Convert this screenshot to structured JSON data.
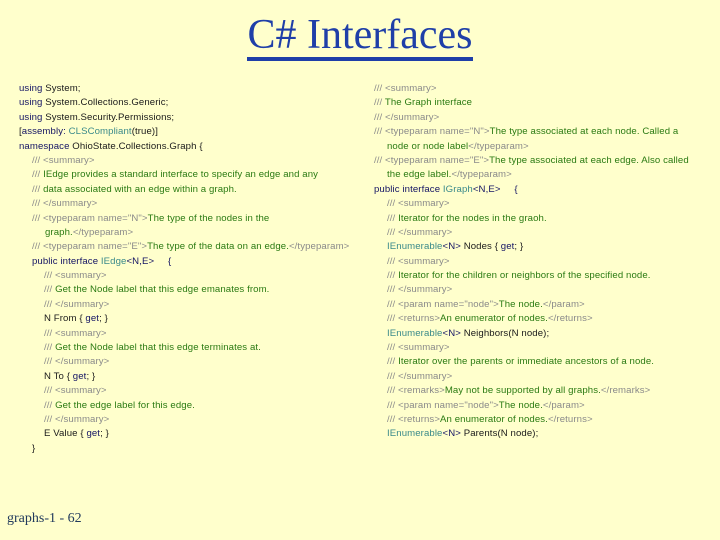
{
  "slide": {
    "title": "C# Interfaces",
    "footer": "graphs-1 - 62"
  },
  "colors": {
    "background": "#ffffcc",
    "title": "#1f3fa8",
    "keyword": "#141464",
    "comment_tag": "#8a8a8a",
    "comment_text": "#2a7a12",
    "type_name": "#3a8a8a"
  },
  "left_code": [
    {
      "indent": 0,
      "parts": [
        {
          "c": "navy",
          "t": "using "
        },
        {
          "c": "black",
          "t": "System;"
        }
      ]
    },
    {
      "indent": 0,
      "parts": [
        {
          "c": "navy",
          "t": "using "
        },
        {
          "c": "black",
          "t": "System.Collections.Generic;"
        }
      ]
    },
    {
      "indent": 0,
      "parts": [
        {
          "c": "navy",
          "t": "using "
        },
        {
          "c": "black",
          "t": "System.Security.Permissions;"
        }
      ]
    },
    {
      "indent": 0,
      "parts": [
        {
          "c": "black",
          "t": "["
        },
        {
          "c": "navy",
          "t": "assembly: "
        },
        {
          "c": "teal",
          "t": "CLSCompliant"
        },
        {
          "c": "black",
          "t": "(true)]"
        }
      ]
    },
    {
      "indent": 0,
      "parts": [
        {
          "c": "navy",
          "t": "namespace "
        },
        {
          "c": "black",
          "t": "OhioState.Collections.Graph {"
        }
      ]
    },
    {
      "indent": 1,
      "parts": [
        {
          "c": "gray",
          "t": "/// <summary>"
        }
      ]
    },
    {
      "indent": 1,
      "parts": [
        {
          "c": "gray",
          "t": "/// "
        },
        {
          "c": "green",
          "t": "IEdge provides a standard interface to specify an edge and any"
        }
      ]
    },
    {
      "indent": 1,
      "parts": [
        {
          "c": "gray",
          "t": "/// "
        },
        {
          "c": "green",
          "t": "data associated with an edge within a graph."
        }
      ]
    },
    {
      "indent": 1,
      "parts": [
        {
          "c": "gray",
          "t": "/// </summary>"
        }
      ]
    },
    {
      "indent": 1,
      "parts": [
        {
          "c": "gray",
          "t": "/// <typeparam name=\"N\">"
        },
        {
          "c": "green",
          "t": "The type of the nodes in the"
        }
      ]
    },
    {
      "indent": 1,
      "cont": true,
      "parts": [
        {
          "c": "green",
          "t": "graph."
        },
        {
          "c": "gray",
          "t": "</typeparam>"
        }
      ]
    },
    {
      "indent": 1,
      "parts": [
        {
          "c": "gray",
          "t": "/// <typeparam name=\"E\">"
        },
        {
          "c": "green",
          "t": "The type of the data on an edge."
        },
        {
          "c": "gray",
          "t": "</typeparam>"
        }
      ]
    },
    {
      "indent": 1,
      "parts": [
        {
          "c": "navy",
          "t": "public interface "
        },
        {
          "c": "teal",
          "t": "IEdge"
        },
        {
          "c": "navy",
          "t": "<N,E>     {"
        }
      ]
    },
    {
      "indent": 2,
      "parts": [
        {
          "c": "gray",
          "t": "/// <summary>"
        }
      ]
    },
    {
      "indent": 2,
      "parts": [
        {
          "c": "gray",
          "t": "/// "
        },
        {
          "c": "green",
          "t": "Get the Node label that this edge emanates from."
        }
      ]
    },
    {
      "indent": 2,
      "parts": [
        {
          "c": "gray",
          "t": "/// </summary>"
        }
      ]
    },
    {
      "indent": 2,
      "parts": [
        {
          "c": "black",
          "t": "N From { "
        },
        {
          "c": "navy",
          "t": "get"
        },
        {
          "c": "black",
          "t": "; }"
        }
      ]
    },
    {
      "indent": 2,
      "parts": [
        {
          "c": "gray",
          "t": "/// <summary>"
        }
      ]
    },
    {
      "indent": 2,
      "parts": [
        {
          "c": "gray",
          "t": "/// "
        },
        {
          "c": "green",
          "t": "Get the Node label that this edge terminates at."
        }
      ]
    },
    {
      "indent": 2,
      "parts": [
        {
          "c": "gray",
          "t": "/// </summary>"
        }
      ]
    },
    {
      "indent": 2,
      "parts": [
        {
          "c": "black",
          "t": "N To { "
        },
        {
          "c": "navy",
          "t": "get"
        },
        {
          "c": "black",
          "t": "; }"
        }
      ]
    },
    {
      "indent": 2,
      "parts": [
        {
          "c": "gray",
          "t": "/// <summary>"
        }
      ]
    },
    {
      "indent": 2,
      "parts": [
        {
          "c": "gray",
          "t": "/// "
        },
        {
          "c": "green",
          "t": "Get the edge label for this edge."
        }
      ]
    },
    {
      "indent": 2,
      "parts": [
        {
          "c": "gray",
          "t": "/// </summary>"
        }
      ]
    },
    {
      "indent": 2,
      "parts": [
        {
          "c": "black",
          "t": "E Value { "
        },
        {
          "c": "navy",
          "t": "get"
        },
        {
          "c": "black",
          "t": "; }"
        }
      ]
    },
    {
      "indent": 1,
      "parts": [
        {
          "c": "black",
          "t": "}"
        }
      ]
    }
  ],
  "right_code": [
    {
      "indent": 0,
      "parts": [
        {
          "c": "gray",
          "t": "/// <summary>"
        }
      ]
    },
    {
      "indent": 0,
      "parts": [
        {
          "c": "gray",
          "t": "/// "
        },
        {
          "c": "green",
          "t": "The Graph interface"
        }
      ]
    },
    {
      "indent": 0,
      "parts": [
        {
          "c": "gray",
          "t": "/// </summary>"
        }
      ]
    },
    {
      "indent": 0,
      "parts": [
        {
          "c": "gray",
          "t": "/// <typeparam name=\"N\">"
        },
        {
          "c": "green",
          "t": "The type associated at each node. Called a"
        }
      ]
    },
    {
      "indent": 0,
      "cont": true,
      "parts": [
        {
          "c": "green",
          "t": "node or node label"
        },
        {
          "c": "gray",
          "t": "</typeparam>"
        }
      ]
    },
    {
      "indent": 0,
      "parts": [
        {
          "c": "gray",
          "t": "/// <typeparam name=\"E\">"
        },
        {
          "c": "green",
          "t": "The type associated at each edge. Also called"
        }
      ]
    },
    {
      "indent": 0,
      "cont": true,
      "parts": [
        {
          "c": "green",
          "t": "the edge label."
        },
        {
          "c": "gray",
          "t": "</typeparam>"
        }
      ]
    },
    {
      "indent": 0,
      "parts": [
        {
          "c": "navy",
          "t": "public interface "
        },
        {
          "c": "teal",
          "t": "IGraph"
        },
        {
          "c": "navy",
          "t": "<N,E>     {"
        }
      ]
    },
    {
      "indent": 1,
      "parts": [
        {
          "c": "gray",
          "t": "/// <summary>"
        }
      ]
    },
    {
      "indent": 1,
      "parts": [
        {
          "c": "gray",
          "t": "/// "
        },
        {
          "c": "green",
          "t": "Iterator for the nodes in the graoh."
        }
      ]
    },
    {
      "indent": 1,
      "parts": [
        {
          "c": "gray",
          "t": "/// </summary>"
        }
      ]
    },
    {
      "indent": 1,
      "parts": [
        {
          "c": "teal",
          "t": "IEnumerable"
        },
        {
          "c": "navy",
          "t": "<N>"
        },
        {
          "c": "black",
          "t": " Nodes { "
        },
        {
          "c": "navy",
          "t": "get"
        },
        {
          "c": "black",
          "t": "; }"
        }
      ]
    },
    {
      "indent": 1,
      "parts": [
        {
          "c": "gray",
          "t": "/// <summary>"
        }
      ]
    },
    {
      "indent": 1,
      "parts": [
        {
          "c": "gray",
          "t": "/// "
        },
        {
          "c": "green",
          "t": "Iterator for the children or neighbors of the specified node."
        }
      ]
    },
    {
      "indent": 1,
      "parts": [
        {
          "c": "gray",
          "t": "/// </summary>"
        }
      ]
    },
    {
      "indent": 1,
      "parts": [
        {
          "c": "gray",
          "t": "/// <param name=\"node\">"
        },
        {
          "c": "green",
          "t": "The node."
        },
        {
          "c": "gray",
          "t": "</param>"
        }
      ]
    },
    {
      "indent": 1,
      "parts": [
        {
          "c": "gray",
          "t": "/// <returns>"
        },
        {
          "c": "green",
          "t": "An enumerator of nodes."
        },
        {
          "c": "gray",
          "t": "</returns>"
        }
      ]
    },
    {
      "indent": 1,
      "parts": [
        {
          "c": "teal",
          "t": "IEnumerable"
        },
        {
          "c": "navy",
          "t": "<N>"
        },
        {
          "c": "black",
          "t": " Neighbors(N node);"
        }
      ]
    },
    {
      "indent": 1,
      "parts": [
        {
          "c": "gray",
          "t": "/// <summary>"
        }
      ]
    },
    {
      "indent": 1,
      "parts": [
        {
          "c": "gray",
          "t": "/// "
        },
        {
          "c": "green",
          "t": "Iterator over the parents or immediate ancestors of a node."
        }
      ]
    },
    {
      "indent": 1,
      "parts": [
        {
          "c": "gray",
          "t": "/// </summary>"
        }
      ]
    },
    {
      "indent": 1,
      "parts": [
        {
          "c": "gray",
          "t": "/// <remarks>"
        },
        {
          "c": "green",
          "t": "May not be supported by all graphs."
        },
        {
          "c": "gray",
          "t": "</remarks>"
        }
      ]
    },
    {
      "indent": 1,
      "parts": [
        {
          "c": "gray",
          "t": "/// <param name=\"node\">"
        },
        {
          "c": "green",
          "t": "The node."
        },
        {
          "c": "gray",
          "t": "</param>"
        }
      ]
    },
    {
      "indent": 1,
      "parts": [
        {
          "c": "gray",
          "t": "/// <returns>"
        },
        {
          "c": "green",
          "t": "An enumerator of nodes."
        },
        {
          "c": "gray",
          "t": "</returns>"
        }
      ]
    },
    {
      "indent": 1,
      "parts": [
        {
          "c": "teal",
          "t": "IEnumerable"
        },
        {
          "c": "navy",
          "t": "<N>"
        },
        {
          "c": "black",
          "t": " Parents(N node);"
        }
      ]
    }
  ]
}
